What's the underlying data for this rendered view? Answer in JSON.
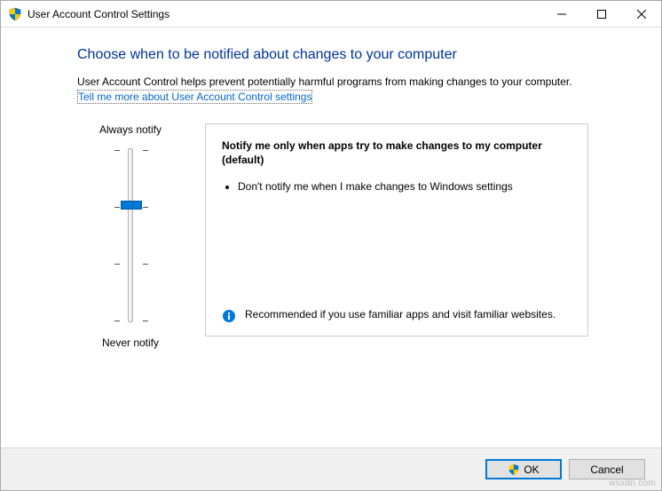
{
  "window": {
    "title": "User Account Control Settings"
  },
  "heading": "Choose when to be notified about changes to your computer",
  "description": "User Account Control helps prevent potentially harmful programs from making changes to your computer.",
  "help_link": "Tell me more about User Account Control settings",
  "slider": {
    "top_label": "Always notify",
    "bottom_label": "Never notify",
    "levels": 4,
    "current_level_from_top": 1
  },
  "panel": {
    "title": "Notify me only when apps try to make changes to my computer (default)",
    "bullet1": "Don't notify me when I make changes to Windows settings",
    "footer": "Recommended if you use familiar apps and visit familiar websites."
  },
  "buttons": {
    "ok": "OK",
    "cancel": "Cancel"
  },
  "watermark": "wsxdn.com"
}
